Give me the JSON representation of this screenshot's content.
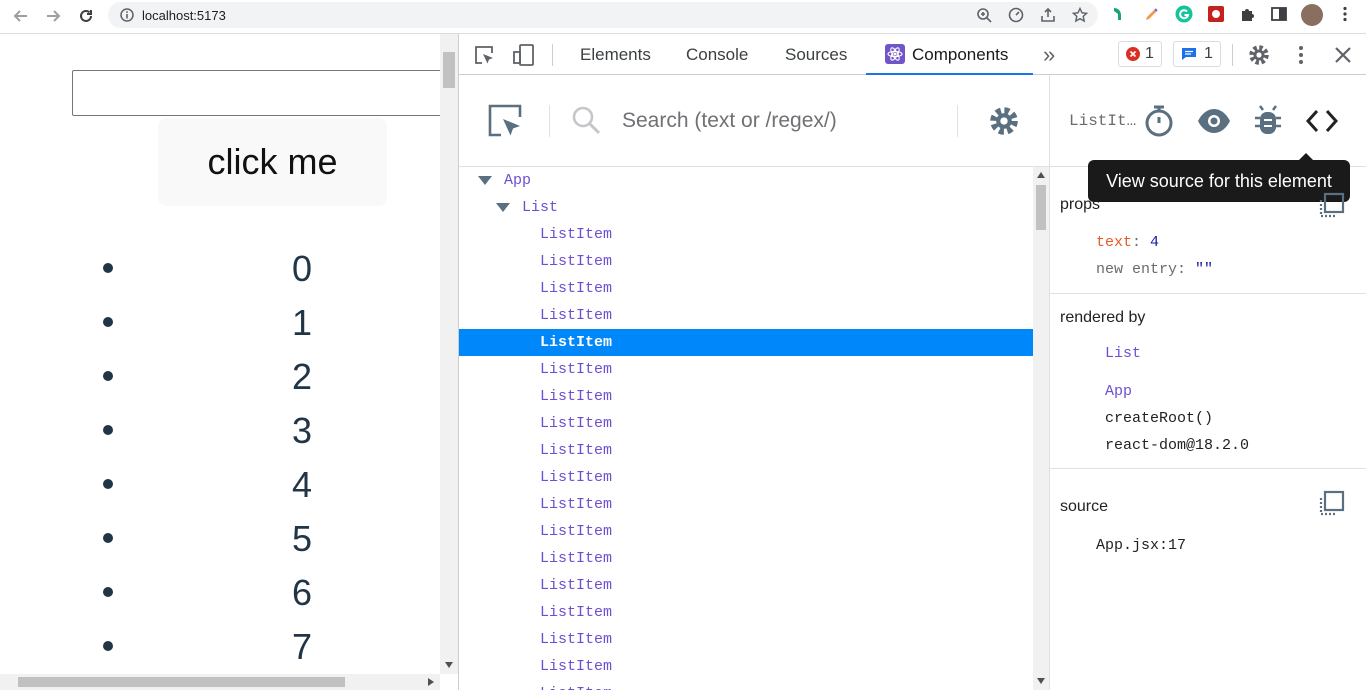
{
  "browser": {
    "url": "localhost:5173"
  },
  "page": {
    "button_label": "click me",
    "list_items": [
      "0",
      "1",
      "2",
      "3",
      "4",
      "5",
      "6",
      "7"
    ]
  },
  "devtools": {
    "tabs": [
      "Elements",
      "Console",
      "Sources",
      "Components"
    ],
    "active_tab": "Components",
    "more_tabs_label": "»",
    "error_count": "1",
    "message_count": "1",
    "search_placeholder": "Search (text or /regex/)",
    "tree": [
      {
        "label": "App",
        "depth": 0,
        "expanded": true,
        "selected": false
      },
      {
        "label": "List",
        "depth": 1,
        "expanded": true,
        "selected": false
      },
      {
        "label": "ListItem",
        "depth": 2,
        "selected": false
      },
      {
        "label": "ListItem",
        "depth": 2,
        "selected": false
      },
      {
        "label": "ListItem",
        "depth": 2,
        "selected": false
      },
      {
        "label": "ListItem",
        "depth": 2,
        "selected": false
      },
      {
        "label": "ListItem",
        "depth": 2,
        "selected": true
      },
      {
        "label": "ListItem",
        "depth": 2,
        "selected": false
      },
      {
        "label": "ListItem",
        "depth": 2,
        "selected": false
      },
      {
        "label": "ListItem",
        "depth": 2,
        "selected": false
      },
      {
        "label": "ListItem",
        "depth": 2,
        "selected": false
      },
      {
        "label": "ListItem",
        "depth": 2,
        "selected": false
      },
      {
        "label": "ListItem",
        "depth": 2,
        "selected": false
      },
      {
        "label": "ListItem",
        "depth": 2,
        "selected": false
      },
      {
        "label": "ListItem",
        "depth": 2,
        "selected": false
      },
      {
        "label": "ListItem",
        "depth": 2,
        "selected": false
      },
      {
        "label": "ListItem",
        "depth": 2,
        "selected": false
      },
      {
        "label": "ListItem",
        "depth": 2,
        "selected": false
      },
      {
        "label": "ListItem",
        "depth": 2,
        "selected": false
      },
      {
        "label": "ListItem",
        "depth": 2,
        "selected": false
      }
    ],
    "inspector": {
      "component_name": "ListIt…",
      "tooltip": "View source for this element",
      "props_title": "props",
      "props": [
        {
          "key": "text",
          "value": "4",
          "key_color": "#e8592b",
          "value_color": "#1a1aa6"
        },
        {
          "key": "new entry",
          "value": "\"\"",
          "key_color": "#6b6b6b",
          "value_color": "#1a1aa6"
        }
      ],
      "rendered_by_title": "rendered by",
      "rendered_by": [
        {
          "label": "List",
          "link": true
        },
        {
          "label": "App",
          "link": true
        },
        {
          "label": "createRoot()",
          "link": false
        },
        {
          "label": "react-dom@18.2.0",
          "link": false
        }
      ],
      "source_title": "source",
      "source_file": "App.jsx:17"
    }
  },
  "colors": {
    "selected_row": "#0088fa",
    "component_name": "#6e4fd1",
    "accent": "#1a73e8"
  }
}
